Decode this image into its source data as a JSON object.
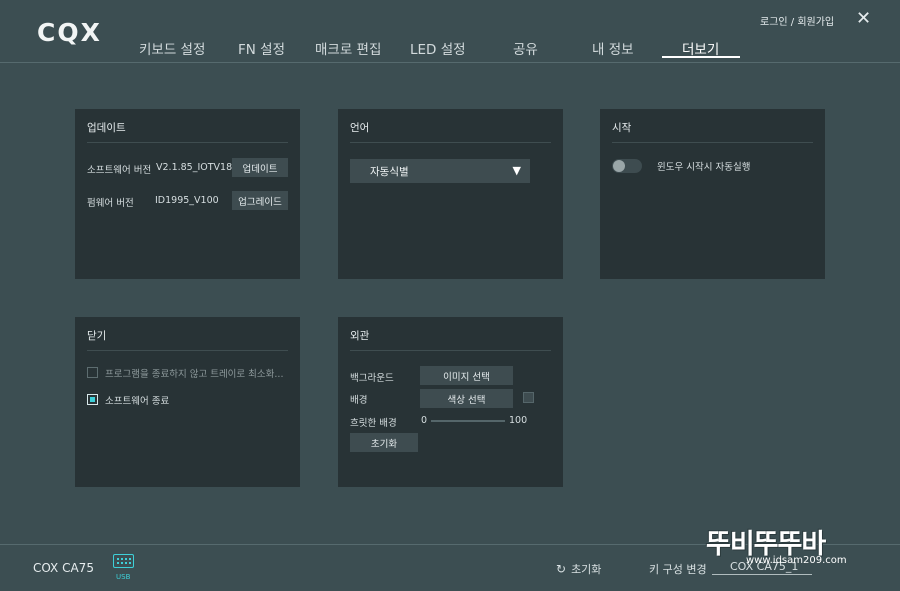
{
  "app": {
    "logo": "CQX"
  },
  "header": {
    "auth_link": "로그인 / 회원가입"
  },
  "nav": {
    "tabs": [
      "키보드 설정",
      "FN 설정",
      "매크로 편집",
      "LED 설정",
      "공유",
      "내 정보",
      "더보기"
    ],
    "active": "더보기"
  },
  "panels": {
    "update": {
      "title": "업데이트",
      "software_label": "소프트웨어 버전",
      "software_version": "V2.1.85_IOTV187",
      "software_button": "업데이트",
      "firmware_label": "펌웨어 버전",
      "firmware_version": "ID1995_V100",
      "firmware_button": "업그레이드"
    },
    "language": {
      "title": "언어",
      "selected": "자동식별",
      "arrow": "▼"
    },
    "startup": {
      "title": "시작",
      "toggle_label": "윈도우 시작시 자동실행",
      "toggle_on": false
    },
    "close": {
      "title": "닫기",
      "option_tray": "프로그램을 종료하지 않고 트레이로 최소화...",
      "option_tray_checked": false,
      "option_exit": "소프트웨어 종료",
      "option_exit_checked": true
    },
    "appearance": {
      "title": "외관",
      "background_label": "백그라운드",
      "background_button": "이미지 선택",
      "color_label": "배경",
      "color_button": "색상 선택",
      "blur_label": "흐릿한 배경",
      "blur_min": "0",
      "blur_max": "100",
      "blur_value": 0,
      "reset_button": "초기화"
    }
  },
  "footer": {
    "device_name": "COX CA75",
    "usb_label": "USB",
    "reset_label": "초기화",
    "reset_icon": "↻",
    "key_config_label": "키 구성 변경",
    "key_config_value": "COX CA75_1"
  },
  "watermark": {
    "text": "뚜비뚜뚜바",
    "url": "www.idsam209.com"
  },
  "colors": {
    "background": "#3c4e52",
    "panel": "#283336",
    "button": "#3e4c50",
    "accent": "#3ed0d8",
    "text": "#d8e0e2"
  }
}
